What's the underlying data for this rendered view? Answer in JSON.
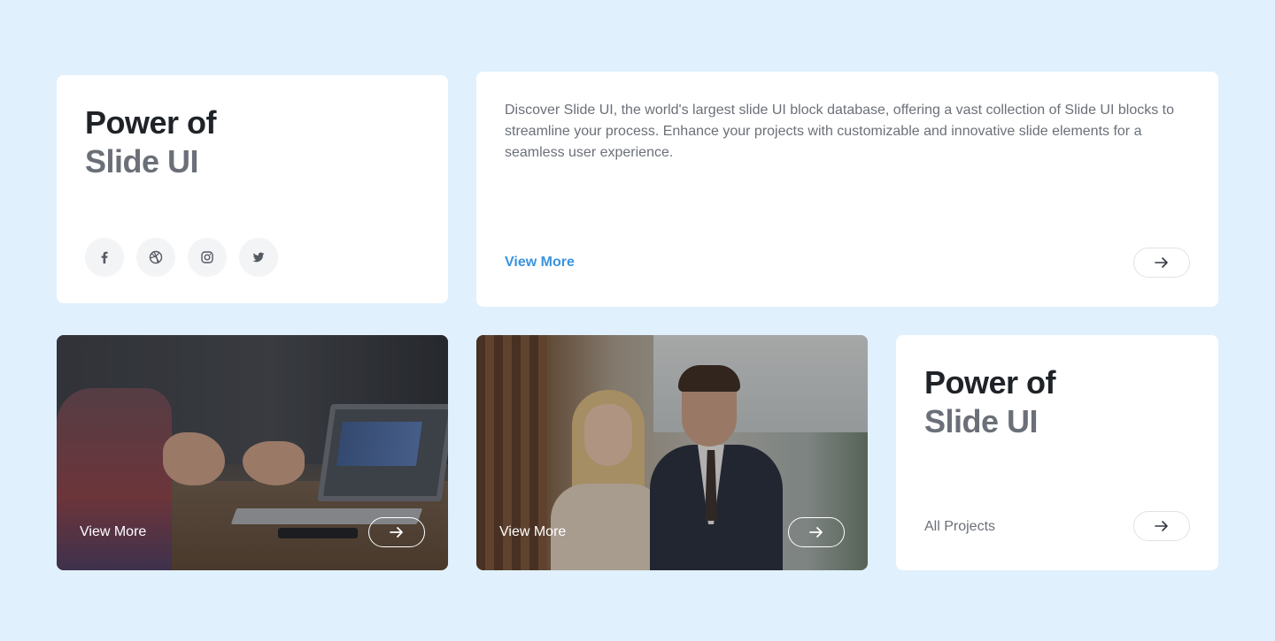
{
  "card_title_1": {
    "line1": "Power of",
    "line2": "Slide UI",
    "socials": [
      "facebook-icon",
      "dribbble-icon",
      "instagram-icon",
      "twitter-icon"
    ]
  },
  "card_description": {
    "text": "Discover Slide UI, the world's largest slide UI block database, offering a vast collection of Slide UI blocks to streamline your process. Enhance your projects with customizable and innovative slide elements for a seamless user experience.",
    "link_label": "View More"
  },
  "image_card_1": {
    "label": "View More"
  },
  "image_card_2": {
    "label": "View More"
  },
  "card_title_2": {
    "line1": "Power of",
    "line2": "Slide UI",
    "link_label": "All Projects"
  },
  "colors": {
    "background": "#e0f0fd",
    "link_blue": "#3b93de",
    "heading_dark": "#1f2328",
    "heading_gray": "#6b7078"
  }
}
